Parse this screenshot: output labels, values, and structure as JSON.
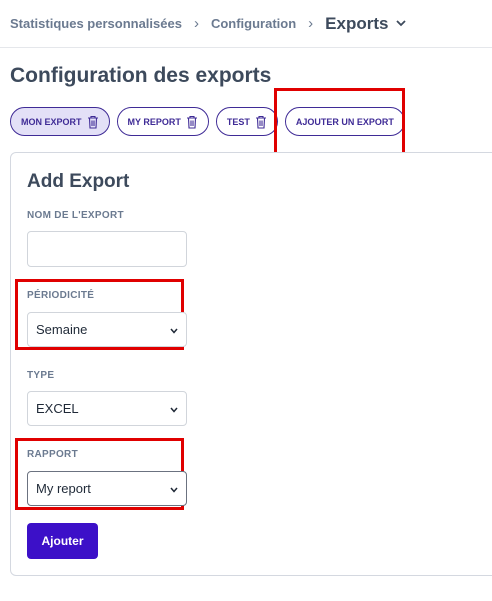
{
  "breadcrumb": {
    "items": [
      "Statistiques personnalisées",
      "Configuration"
    ],
    "current": "Exports"
  },
  "page": {
    "title": "Configuration des exports"
  },
  "exports": {
    "items": [
      "MON EXPORT",
      "MY REPORT",
      "TEST"
    ],
    "add_label": "AJOUTER UN EXPORT"
  },
  "form": {
    "title": "Add Export",
    "name_label": "NOM DE L'EXPORT",
    "name_value": "",
    "periodicity_label": "PÉRIODICITÉ",
    "periodicity_value": "Semaine",
    "type_label": "TYPE",
    "type_value": "EXCEL",
    "report_label": "RAPPORT",
    "report_value": "My report",
    "submit_label": "Ajouter"
  },
  "colors": {
    "accent": "#3c10c8",
    "pill_border": "#3f2b96",
    "active_pill_bg": "#e3e0f7",
    "highlight": "#e00000"
  },
  "icons": {
    "breadcrumb_separator": "chevron-right-icon",
    "breadcrumb_dropdown": "chevron-down-icon",
    "delete": "trash-icon",
    "select": "chevron-down-icon"
  }
}
